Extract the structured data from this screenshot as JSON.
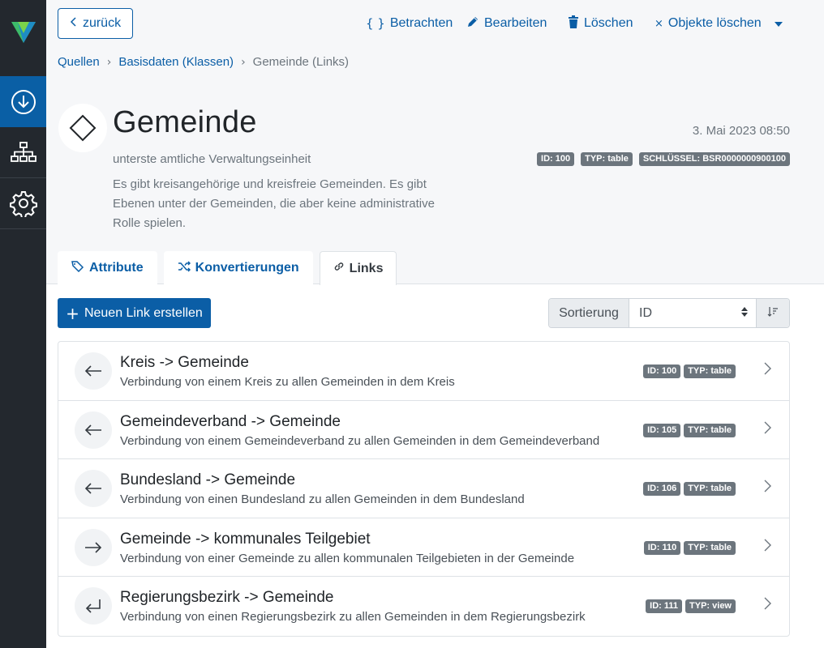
{
  "sidebar": {
    "logo": "brand-logo",
    "items": [
      {
        "name": "download-icon",
        "active": true
      },
      {
        "name": "hierarchy-icon",
        "active": false
      },
      {
        "name": "gear-icon",
        "active": false
      }
    ]
  },
  "header": {
    "back_label": "zurück",
    "actions": {
      "view": "Betrachten",
      "edit": "Bearbeiten",
      "delete": "Löschen",
      "delete_objects": "Objekte löschen"
    },
    "breadcrumb": [
      "Quellen",
      "Basisdaten (Klassen)",
      "Gemeinde (Links)"
    ],
    "title": "Gemeinde",
    "subtitle": "unterste amtliche Verwaltungseinheit",
    "description": "Es gibt kreisangehörige und kreisfreie Gemeinden. Es gibt Ebenen unter der Gemeinden, die aber keine administrative Rolle spielen.",
    "timestamp": "3. Mai 2023 08:50",
    "badges": {
      "id": "ID: 100",
      "type": "TYP: table",
      "key": "SCHLÜSSEL: BSR0000000900100"
    }
  },
  "tabs": [
    {
      "label": "Attribute",
      "icon": "tags-icon",
      "active": false
    },
    {
      "label": "Konvertierungen",
      "icon": "shuffle-icon",
      "active": false
    },
    {
      "label": "Links",
      "icon": "link-icon",
      "active": true
    }
  ],
  "content": {
    "new_link_label": "Neuen Link erstellen",
    "sort_label": "Sortierung",
    "sort_value": "ID"
  },
  "links": [
    {
      "title": "Kreis -> Gemeinde",
      "description": "Verbindung von einem Kreis zu allen Gemeinden in dem Kreis",
      "id": "ID: 100",
      "type": "TYP: table",
      "direction": "arrow-left-icon"
    },
    {
      "title": "Gemeindeverband -> Gemeinde",
      "description": "Verbindung von einem Gemeindeverband zu allen Gemeinden in dem Gemeindeverband",
      "id": "ID: 105",
      "type": "TYP: table",
      "direction": "arrow-left-icon"
    },
    {
      "title": "Bundesland -> Gemeinde",
      "description": "Verbindung von einen Bundesland zu allen Gemeinden in dem Bundesland",
      "id": "ID: 106",
      "type": "TYP: table",
      "direction": "arrow-left-icon"
    },
    {
      "title": "Gemeinde -> kommunales Teilgebiet",
      "description": "Verbindung von einer Gemeinde zu allen kommunalen Teilgebieten in der Gemeinde",
      "id": "ID: 110",
      "type": "TYP: table",
      "direction": "arrow-right-icon"
    },
    {
      "title": "Regierungsbezirk -> Gemeinde",
      "description": "Verbindung von einen Regierungsbezirk zu allen Gemeinden in dem Regierungsbezirk",
      "id": "ID: 111",
      "type": "TYP: view",
      "direction": "return-arrow-icon"
    }
  ],
  "colors": {
    "primary": "#0b5ea6",
    "sidebar": "#23282e",
    "sidebar_active": "#0a5fa5",
    "badge": "#6c757d"
  }
}
